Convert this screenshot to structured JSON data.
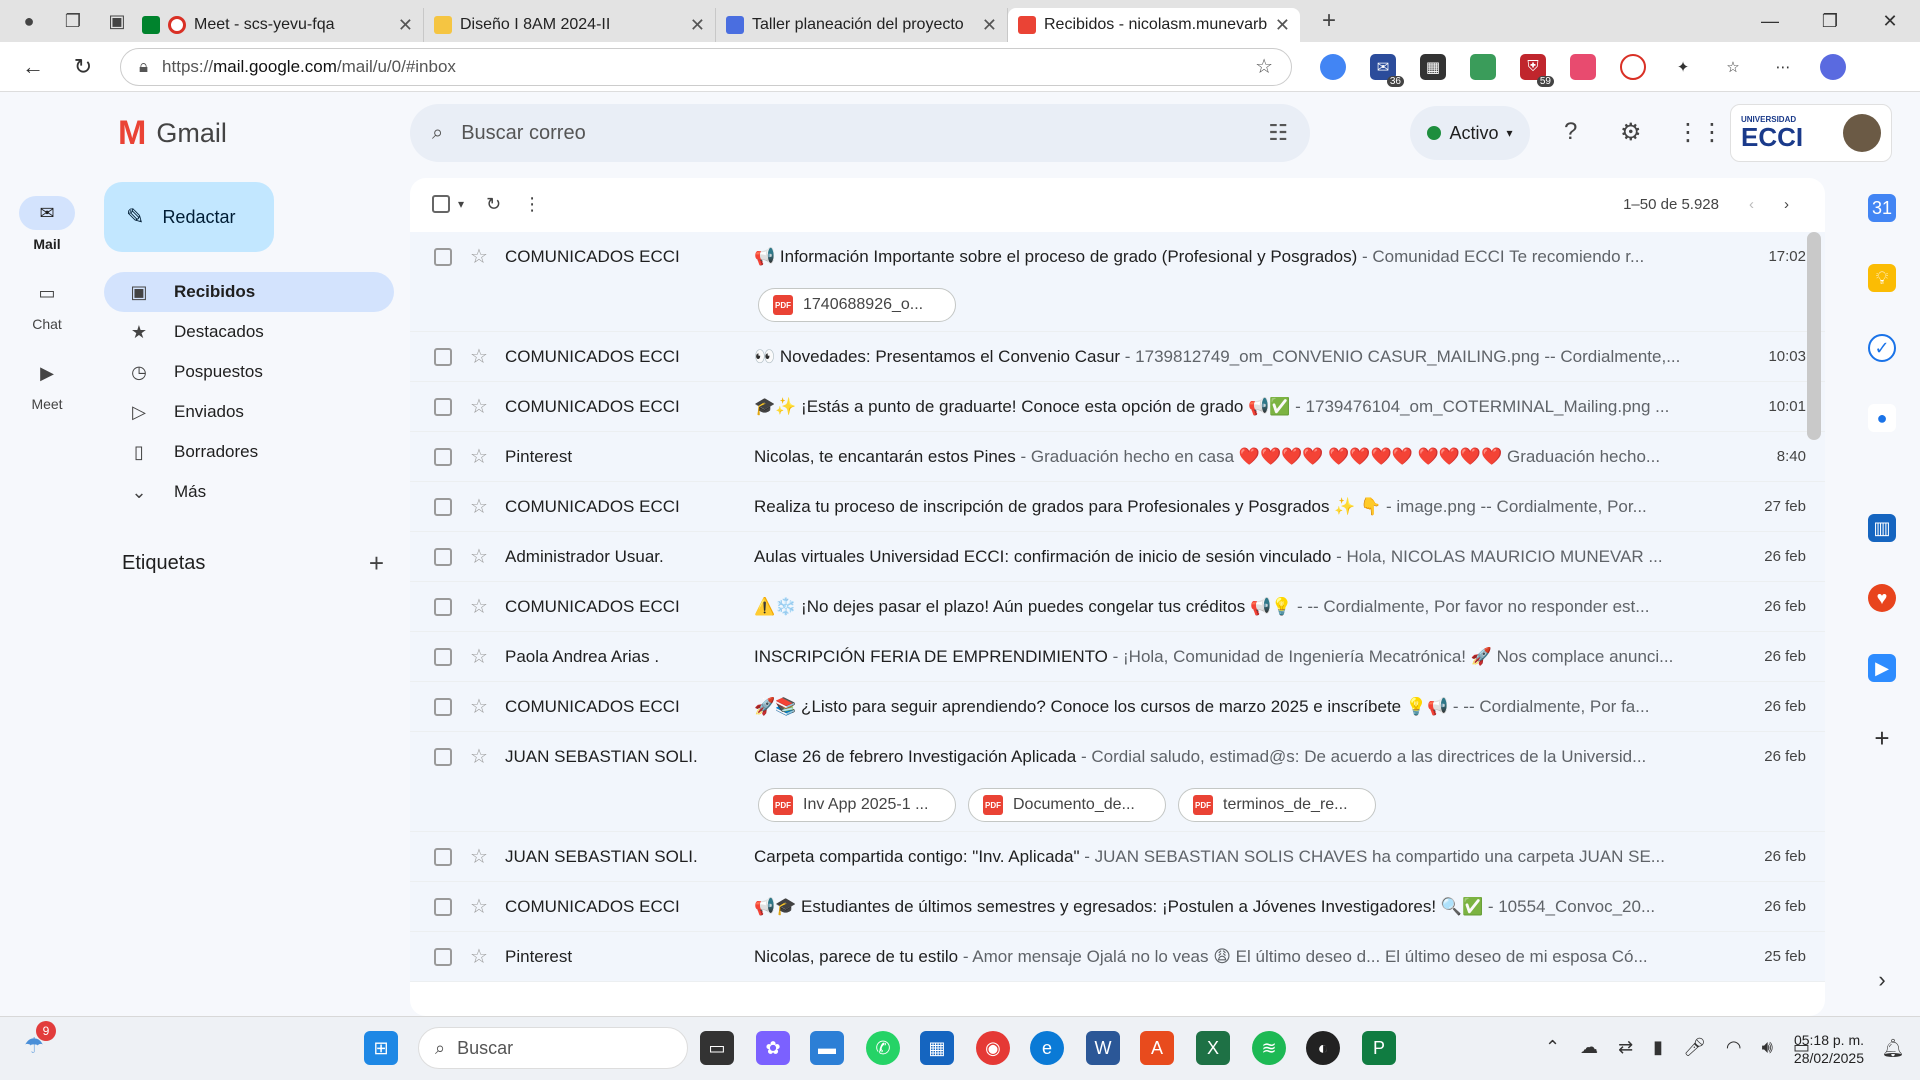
{
  "browser": {
    "tabs": [
      {
        "title": "Meet - scs-yevu-fqa",
        "icon_color": "#00832d"
      },
      {
        "title": "Diseño I 8AM 2024-II",
        "icon_color": "#f5c542"
      },
      {
        "title": "Taller planeación del proyecto",
        "icon_color": "#4a6ee0"
      },
      {
        "title": "Recibidos - nicolasm.munevarb@",
        "icon_color": "#ea4335"
      }
    ],
    "url_prefix": "https://",
    "url_host": "mail.google.com",
    "url_path": "/mail/u/0/#inbox",
    "ext_badges": [
      "36",
      "59"
    ]
  },
  "rail": {
    "items": [
      {
        "label": "Mail",
        "icon": "mail-icon"
      },
      {
        "label": "Chat",
        "icon": "chat-icon"
      },
      {
        "label": "Meet",
        "icon": "video-icon"
      }
    ]
  },
  "header": {
    "brand": "Gmail",
    "search_placeholder": "Buscar correo",
    "status": "Activo",
    "org": "ECCI",
    "org_small": "UNIVERSIDAD"
  },
  "compose_label": "Redactar",
  "nav": [
    {
      "label": "Recibidos",
      "icon": "inbox-icon"
    },
    {
      "label": "Destacados",
      "icon": "star-icon"
    },
    {
      "label": "Pospuestos",
      "icon": "clock-icon"
    },
    {
      "label": "Enviados",
      "icon": "send-icon"
    },
    {
      "label": "Borradores",
      "icon": "draft-icon"
    },
    {
      "label": "Más",
      "icon": "chevron-down-icon"
    }
  ],
  "labels_title": "Etiquetas",
  "pager": "1–50 de 5.928",
  "emails": [
    {
      "sender": "COMUNICADOS ECCI",
      "subject": "📢 Información Importante sobre el proceso de grado (Profesional y Posgrados)",
      "snippet": " - Comunidad ECCI Te recomiendo r...",
      "date": "17:02",
      "attachments": [
        "1740688926_o..."
      ]
    },
    {
      "sender": "COMUNICADOS ECCI",
      "subject": "👀 Novedades: Presentamos el Convenio Casur",
      "snippet": " - 1739812749_om_CONVENIO CASUR_MAILING.png -- Cordialmente,...",
      "date": "10:03",
      "attachments": []
    },
    {
      "sender": "COMUNICADOS ECCI",
      "subject": "🎓✨ ¡Estás a punto de graduarte! Conoce esta opción de grado 📢✅",
      "snippet": " - 1739476104_om_COTERMINAL_Mailing.png ...",
      "date": "10:01",
      "attachments": []
    },
    {
      "sender": "Pinterest",
      "subject": "Nicolas, te encantarán estos Pines",
      "snippet": " - Graduación hecho en casa ❤️❤️❤️❤️ ❤️❤️❤️❤️ ❤️❤️❤️❤️ Graduación hecho...",
      "date": "8:40",
      "attachments": []
    },
    {
      "sender": "COMUNICADOS ECCI",
      "subject": "Realiza tu proceso de inscripción de grados para Profesionales y Posgrados ✨ 👇",
      "snippet": " - image.png -- Cordialmente, Por...",
      "date": "27 feb",
      "attachments": []
    },
    {
      "sender": "Administrador Usuar.",
      "subject": "Aulas virtuales Universidad ECCI: confirmación de inicio de sesión vinculado",
      "snippet": " - Hola, NICOLAS MAURICIO MUNEVAR ...",
      "date": "26 feb",
      "attachments": []
    },
    {
      "sender": "COMUNICADOS ECCI",
      "subject": "⚠️❄️ ¡No dejes pasar el plazo! Aún puedes congelar tus créditos 📢💡",
      "snippet": " - -- Cordialmente, Por favor no responder est...",
      "date": "26 feb",
      "attachments": []
    },
    {
      "sender": "Paola Andrea Arias .",
      "subject": "INSCRIPCIÓN FERIA DE EMPRENDIMIENTO",
      "snippet": " - ¡Hola, Comunidad de Ingeniería Mecatrónica! 🚀 Nos complace anunci...",
      "date": "26 feb",
      "attachments": []
    },
    {
      "sender": "COMUNICADOS ECCI",
      "subject": "🚀📚 ¿Listo para seguir aprendiendo? Conoce los cursos de marzo 2025 e inscríbete 💡📢",
      "snippet": " - -- Cordialmente, Por fa...",
      "date": "26 feb",
      "attachments": []
    },
    {
      "sender": "JUAN SEBASTIAN SOLI.",
      "subject": "Clase 26 de febrero Investigación Aplicada",
      "snippet": " - Cordial saludo, estimad@s: De acuerdo a las directrices de la Universid...",
      "date": "26 feb",
      "attachments": [
        "Inv App 2025-1 ...",
        "Documento_de...",
        "terminos_de_re..."
      ]
    },
    {
      "sender": "JUAN SEBASTIAN SOLI.",
      "subject": "Carpeta compartida contigo: \"Inv. Aplicada\"",
      "snippet": " - JUAN SEBASTIAN SOLIS CHAVES ha compartido una carpeta JUAN SE...",
      "date": "26 feb",
      "attachments": []
    },
    {
      "sender": "COMUNICADOS ECCI",
      "subject": "📢🎓 Estudiantes de últimos semestres y egresados: ¡Postulen a Jóvenes Investigadores! 🔍✅",
      "snippet": " - 10554_Convoc_20...",
      "date": "26 feb",
      "attachments": []
    },
    {
      "sender": "Pinterest",
      "subject": "Nicolas, parece de tu estilo",
      "snippet": " - Amor mensaje Ojalá no lo veas 😩 El último deseo d... El último deseo de mi esposa Có...",
      "date": "25 feb",
      "attachments": []
    }
  ],
  "taskbar": {
    "search_placeholder": "Buscar",
    "weather_badge": "9",
    "time": "05:18 p. m.",
    "date": "28/02/2025"
  },
  "colors": {
    "accent": "#d3e3fd",
    "compose": "#c2e7ff",
    "row_bg": "#f2f6fc"
  }
}
